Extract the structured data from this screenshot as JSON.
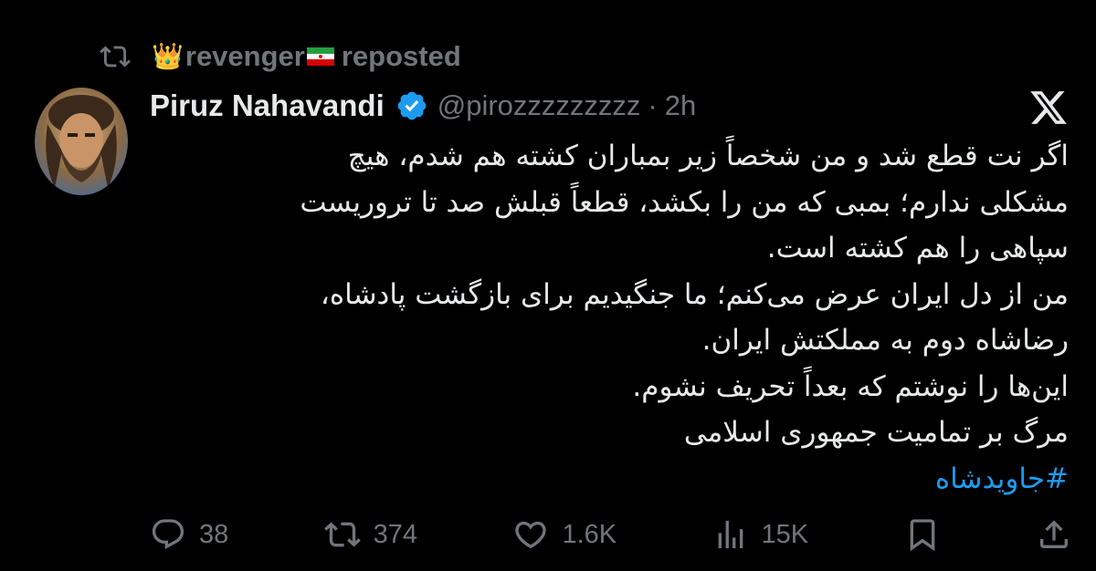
{
  "repost": {
    "icon": "retweet-icon",
    "user_name": "revenger",
    "crown_emoji": "👑",
    "flag_icon": "iran-flag-icon",
    "label": "reposted"
  },
  "tweet": {
    "display_name": "Piruz Nahavandi",
    "verified_icon": "verified-badge-icon",
    "handle": "@pirozzzzzzzzz",
    "separator": "·",
    "time": "2h",
    "lines": [
      "اگر نت قطع شد و من شخصاً زیر بمباران کشته هم شدم، هیچ",
      "مشکلی ندارم؛ بمبی که من را بکشد، قطعاً قبلش صد تا تروریست",
      "سپاهی را هم کشته است.",
      "من از دل ایران عرض می‌کنم؛ ما جنگیدیم برای بازگشت پادشاه،",
      "رضاشاه دوم به مملکتش ایران.",
      "این‌ها را نوشتم که بعداً تحریف نشوم.",
      "مرگ بر تمامیت جمهوری اسلامی"
    ],
    "hashtag": "#جاویدشاه"
  },
  "actions": {
    "replies": "38",
    "reposts": "374",
    "likes": "1.6K",
    "views": "15K"
  },
  "colors": {
    "background": "#000000",
    "text": "#e7e9ea",
    "muted": "#71767b",
    "accent": "#1d9bf0"
  }
}
